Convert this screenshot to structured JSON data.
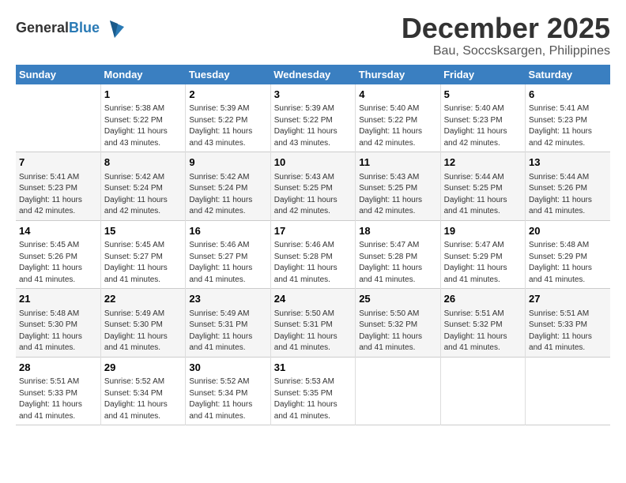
{
  "header": {
    "logo_line1": "General",
    "logo_line2": "Blue",
    "title": "December 2025",
    "subtitle": "Bau, Soccsksargen, Philippines"
  },
  "days_of_week": [
    "Sunday",
    "Monday",
    "Tuesday",
    "Wednesday",
    "Thursday",
    "Friday",
    "Saturday"
  ],
  "weeks": [
    [
      {
        "day": "",
        "info": ""
      },
      {
        "day": "1",
        "info": "Sunrise: 5:38 AM\nSunset: 5:22 PM\nDaylight: 11 hours\nand 43 minutes."
      },
      {
        "day": "2",
        "info": "Sunrise: 5:39 AM\nSunset: 5:22 PM\nDaylight: 11 hours\nand 43 minutes."
      },
      {
        "day": "3",
        "info": "Sunrise: 5:39 AM\nSunset: 5:22 PM\nDaylight: 11 hours\nand 43 minutes."
      },
      {
        "day": "4",
        "info": "Sunrise: 5:40 AM\nSunset: 5:22 PM\nDaylight: 11 hours\nand 42 minutes."
      },
      {
        "day": "5",
        "info": "Sunrise: 5:40 AM\nSunset: 5:23 PM\nDaylight: 11 hours\nand 42 minutes."
      },
      {
        "day": "6",
        "info": "Sunrise: 5:41 AM\nSunset: 5:23 PM\nDaylight: 11 hours\nand 42 minutes."
      }
    ],
    [
      {
        "day": "7",
        "info": "Sunrise: 5:41 AM\nSunset: 5:23 PM\nDaylight: 11 hours\nand 42 minutes."
      },
      {
        "day": "8",
        "info": "Sunrise: 5:42 AM\nSunset: 5:24 PM\nDaylight: 11 hours\nand 42 minutes."
      },
      {
        "day": "9",
        "info": "Sunrise: 5:42 AM\nSunset: 5:24 PM\nDaylight: 11 hours\nand 42 minutes."
      },
      {
        "day": "10",
        "info": "Sunrise: 5:43 AM\nSunset: 5:25 PM\nDaylight: 11 hours\nand 42 minutes."
      },
      {
        "day": "11",
        "info": "Sunrise: 5:43 AM\nSunset: 5:25 PM\nDaylight: 11 hours\nand 42 minutes."
      },
      {
        "day": "12",
        "info": "Sunrise: 5:44 AM\nSunset: 5:25 PM\nDaylight: 11 hours\nand 41 minutes."
      },
      {
        "day": "13",
        "info": "Sunrise: 5:44 AM\nSunset: 5:26 PM\nDaylight: 11 hours\nand 41 minutes."
      }
    ],
    [
      {
        "day": "14",
        "info": "Sunrise: 5:45 AM\nSunset: 5:26 PM\nDaylight: 11 hours\nand 41 minutes."
      },
      {
        "day": "15",
        "info": "Sunrise: 5:45 AM\nSunset: 5:27 PM\nDaylight: 11 hours\nand 41 minutes."
      },
      {
        "day": "16",
        "info": "Sunrise: 5:46 AM\nSunset: 5:27 PM\nDaylight: 11 hours\nand 41 minutes."
      },
      {
        "day": "17",
        "info": "Sunrise: 5:46 AM\nSunset: 5:28 PM\nDaylight: 11 hours\nand 41 minutes."
      },
      {
        "day": "18",
        "info": "Sunrise: 5:47 AM\nSunset: 5:28 PM\nDaylight: 11 hours\nand 41 minutes."
      },
      {
        "day": "19",
        "info": "Sunrise: 5:47 AM\nSunset: 5:29 PM\nDaylight: 11 hours\nand 41 minutes."
      },
      {
        "day": "20",
        "info": "Sunrise: 5:48 AM\nSunset: 5:29 PM\nDaylight: 11 hours\nand 41 minutes."
      }
    ],
    [
      {
        "day": "21",
        "info": "Sunrise: 5:48 AM\nSunset: 5:30 PM\nDaylight: 11 hours\nand 41 minutes."
      },
      {
        "day": "22",
        "info": "Sunrise: 5:49 AM\nSunset: 5:30 PM\nDaylight: 11 hours\nand 41 minutes."
      },
      {
        "day": "23",
        "info": "Sunrise: 5:49 AM\nSunset: 5:31 PM\nDaylight: 11 hours\nand 41 minutes."
      },
      {
        "day": "24",
        "info": "Sunrise: 5:50 AM\nSunset: 5:31 PM\nDaylight: 11 hours\nand 41 minutes."
      },
      {
        "day": "25",
        "info": "Sunrise: 5:50 AM\nSunset: 5:32 PM\nDaylight: 11 hours\nand 41 minutes."
      },
      {
        "day": "26",
        "info": "Sunrise: 5:51 AM\nSunset: 5:32 PM\nDaylight: 11 hours\nand 41 minutes."
      },
      {
        "day": "27",
        "info": "Sunrise: 5:51 AM\nSunset: 5:33 PM\nDaylight: 11 hours\nand 41 minutes."
      }
    ],
    [
      {
        "day": "28",
        "info": "Sunrise: 5:51 AM\nSunset: 5:33 PM\nDaylight: 11 hours\nand 41 minutes."
      },
      {
        "day": "29",
        "info": "Sunrise: 5:52 AM\nSunset: 5:34 PM\nDaylight: 11 hours\nand 41 minutes."
      },
      {
        "day": "30",
        "info": "Sunrise: 5:52 AM\nSunset: 5:34 PM\nDaylight: 11 hours\nand 41 minutes."
      },
      {
        "day": "31",
        "info": "Sunrise: 5:53 AM\nSunset: 5:35 PM\nDaylight: 11 hours\nand 41 minutes."
      },
      {
        "day": "",
        "info": ""
      },
      {
        "day": "",
        "info": ""
      },
      {
        "day": "",
        "info": ""
      }
    ]
  ]
}
